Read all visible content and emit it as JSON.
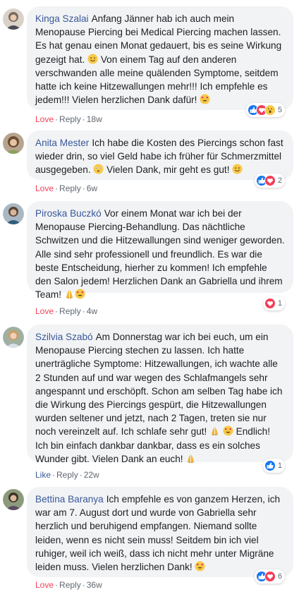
{
  "comments": [
    {
      "author": "Kinga Szalai",
      "text_parts": [
        "Anfang Jänner hab ich auch mein Menopause Piercing bei Medical Piercing machen lassen. Es hat genau einen Monat gedauert, bis es seine Wirkung gezeigt hat. ",
        " Von einem Tag auf den anderen verschwanden alle meine quälenden Symptome, seitdem hatte ich keine Hitzewallungen mehr!!! Ich empfehle es jedem!!! Vielen herzlichen Dank dafür! "
      ],
      "reaction_count": "5",
      "reaction_label": "Love",
      "reply_label": "Reply",
      "time": "18w"
    },
    {
      "author": "Anita Mester",
      "text_parts": [
        "Ich habe die Kosten des Piercings schon fast wieder drin, so viel Geld habe ich früher für Schmerzmittel ausgegeben. ",
        " Vielen Dank, mir geht es gut! "
      ],
      "reaction_count": "2",
      "reaction_label": "Love",
      "reply_label": "Reply",
      "time": "6w"
    },
    {
      "author": "Piroska Buczkó",
      "text_parts": [
        "Vor einem Monat war ich bei der Menopause Piercing-Behandlung. Das nächtliche Schwitzen und die Hitzewallungen sind weniger geworden. Alle sind sehr professionell und freundlich. Es war die beste Entscheidung, hierher zu kommen! Ich empfehle den Salon jedem! Herzlichen Dank an Gabriella und ihrem Team! "
      ],
      "reaction_count": "1",
      "reaction_label": "Love",
      "reply_label": "Reply",
      "time": "4w"
    },
    {
      "author": "Szilvia Szabó",
      "text_parts": [
        "Am Donnerstag war ich bei euch, um ein Menopause Piercing stechen zu lassen. Ich hatte unerträgliche Symptome: Hitzewallungen, ich wachte alle 2 Stunden auf und war wegen des Schlafmangels sehr angespannt und erschöpft. Schon am selben Tag habe ich die Wirkung des Piercings gespürt, die Hitzewallungen wurden seltener und jetzt, nach 2 Tagen, treten sie nur noch vereinzelt auf. Ich schlafe sehr gut! ",
        " Endlich! Ich bin einfach dankbar dankbar, dass es ein solches Wunder gibt. Vielen Dank an euch! "
      ],
      "reaction_count": "1",
      "reaction_label": "Like",
      "reply_label": "Reply",
      "time": "22w"
    },
    {
      "author": "Bettina Baranya",
      "text_parts": [
        "Ich empfehle es von ganzem Herzen, ich war am 7. August dort und wurde von Gabriella sehr herzlich und beruhigend empfangen. Niemand sollte leiden, wenn es nicht sein muss! Seitdem bin ich viel ruhiger, weil ich weiß, dass ich nicht mehr unter Migräne leiden muss. Vielen herzlichen Dank! "
      ],
      "reaction_count": "6",
      "reaction_label": "Love",
      "reply_label": "Reply",
      "time": "36w"
    }
  ],
  "separator": "·",
  "colors": {
    "author": "#385898",
    "love": "#f33e58",
    "like": "#385898",
    "bubble": "#f2f3f5",
    "meta": "#606770"
  }
}
